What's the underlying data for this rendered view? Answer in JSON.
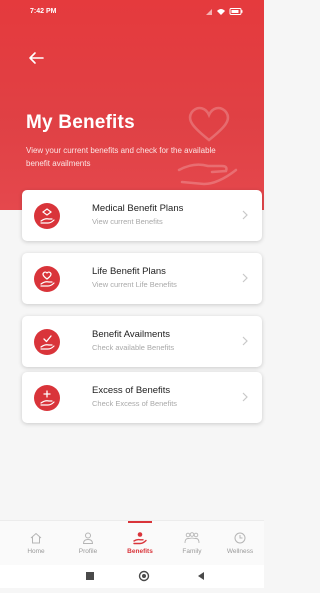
{
  "status": {
    "time": "7:42 PM"
  },
  "header": {
    "title": "My Benefits",
    "subtitle": "View your current benefits and check for the available benefit availments"
  },
  "cards": [
    {
      "title": "Medical Benefit Plans",
      "subtitle": "View current Benefits",
      "icon": "medical-plan-icon"
    },
    {
      "title": "Life Benefit Plans",
      "subtitle": "View current Life Benefits",
      "icon": "life-plan-icon"
    },
    {
      "title": "Benefit Availments",
      "subtitle": "Check available Benefits",
      "icon": "availment-icon"
    },
    {
      "title": "Excess of Benefits",
      "subtitle": "Check Excess of Benefits",
      "icon": "excess-icon"
    }
  ],
  "nav": [
    {
      "label": "Home",
      "icon": "home-icon"
    },
    {
      "label": "Profile",
      "icon": "profile-icon"
    },
    {
      "label": "Benefits",
      "icon": "benefits-icon",
      "active": true
    },
    {
      "label": "Family",
      "icon": "family-icon"
    },
    {
      "label": "Wellness",
      "icon": "wellness-icon"
    }
  ],
  "colors": {
    "accent": "#d9343a",
    "header": "#e53a3d",
    "background": "#f6f6f6"
  }
}
